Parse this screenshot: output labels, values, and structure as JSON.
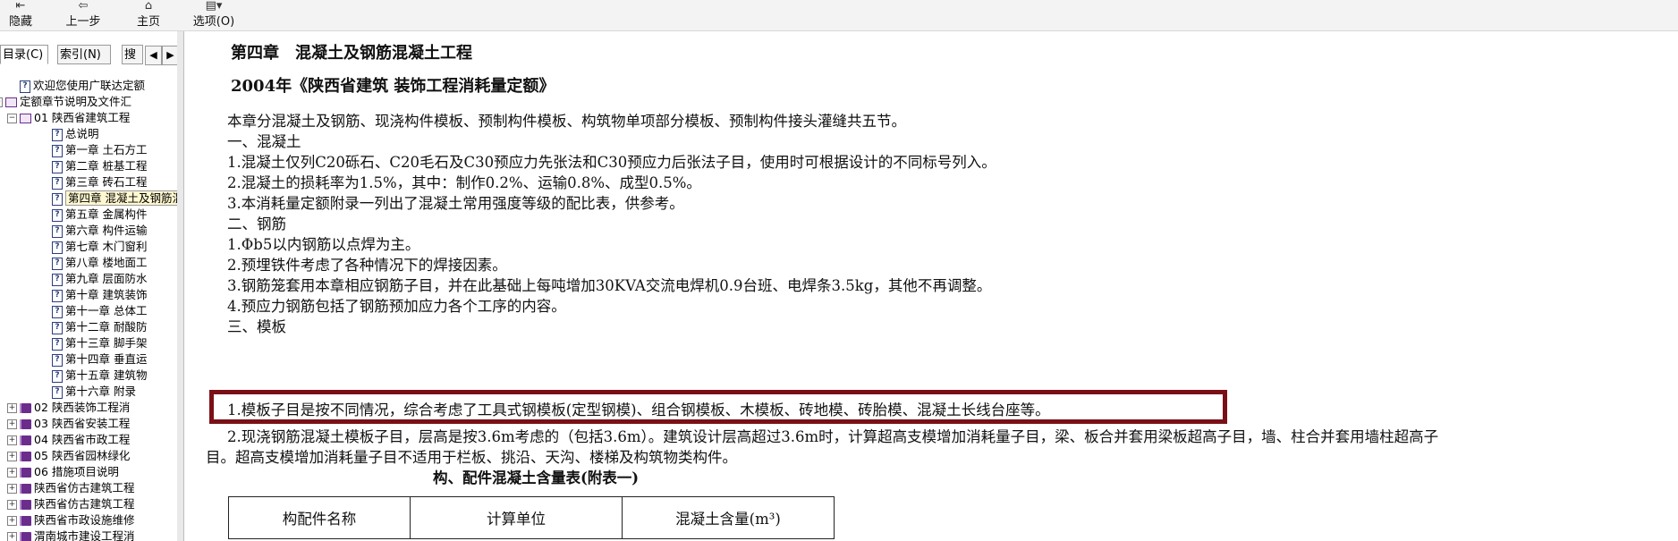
{
  "toolbar": {
    "buttons": [
      {
        "label": "隐藏",
        "icon": "hide-icon",
        "glyph": "⇤"
      },
      {
        "label": "上一步",
        "icon": "back-arrow-icon",
        "glyph": "⇦"
      },
      {
        "label": "主页",
        "icon": "home-icon",
        "glyph": "⌂"
      },
      {
        "label": "选项(O)",
        "icon": "options-icon",
        "glyph": "▤▾"
      }
    ]
  },
  "tabs": {
    "contents": "目录(C)",
    "index": "索引(N)",
    "search": "搜",
    "prev": "◀",
    "next": "▶"
  },
  "tree": [
    {
      "text": "欢迎您使用广联达定额",
      "icon": "doc",
      "level": 1
    },
    {
      "text": "定额章节说明及文件汇",
      "icon": "bookopen",
      "level": 0,
      "exp": "−"
    },
    {
      "text": "01 陕西省建筑工程",
      "icon": "bookopen",
      "level": 1,
      "exp": "−"
    },
    {
      "text": "总说明",
      "icon": "doc",
      "level": 3
    },
    {
      "text": "第一章 土石方工",
      "icon": "doc",
      "level": 3
    },
    {
      "text": "第二章 桩基工程",
      "icon": "doc",
      "level": 3
    },
    {
      "text": "第三章 砖石工程",
      "icon": "doc",
      "level": 3
    },
    {
      "text": "第四章 混凝土及钢筋混凝土工程",
      "icon": "doc",
      "level": 3,
      "selected": true
    },
    {
      "text": "第五章 金属构件",
      "icon": "doc",
      "level": 3
    },
    {
      "text": "第六章 构件运输",
      "icon": "doc",
      "level": 3
    },
    {
      "text": "第七章 木门窗利",
      "icon": "doc",
      "level": 3
    },
    {
      "text": "第八章 楼地面工",
      "icon": "doc",
      "level": 3
    },
    {
      "text": "第九章 层面防水",
      "icon": "doc",
      "level": 3
    },
    {
      "text": "第十章 建筑装饰",
      "icon": "doc",
      "level": 3
    },
    {
      "text": "第十一章 总体工",
      "icon": "doc",
      "level": 3
    },
    {
      "text": "第十二章 耐酸防",
      "icon": "doc",
      "level": 3
    },
    {
      "text": "第十三章 脚手架",
      "icon": "doc",
      "level": 3
    },
    {
      "text": "第十四章 垂直运",
      "icon": "doc",
      "level": 3
    },
    {
      "text": "第十五章 建筑物",
      "icon": "doc",
      "level": 3
    },
    {
      "text": "第十六章 附录",
      "icon": "doc",
      "level": 3
    },
    {
      "text": "02 陕西装饰工程消",
      "icon": "book",
      "level": 1,
      "exp": "+"
    },
    {
      "text": "03 陕西省安装工程",
      "icon": "book",
      "level": 1,
      "exp": "+"
    },
    {
      "text": "04 陕西省市政工程",
      "icon": "book",
      "level": 1,
      "exp": "+"
    },
    {
      "text": "05 陕西省园林绿化",
      "icon": "book",
      "level": 1,
      "exp": "+"
    },
    {
      "text": "06 措施项目说明",
      "icon": "book",
      "level": 1,
      "exp": "+"
    },
    {
      "text": "陕西省仿古建筑工程",
      "icon": "book",
      "level": 1,
      "exp": "+"
    },
    {
      "text": "陕西省仿古建筑工程",
      "icon": "book",
      "level": 1,
      "exp": "+"
    },
    {
      "text": "陕西省市政设施维修",
      "icon": "book",
      "level": 1,
      "exp": "+"
    },
    {
      "text": "渭南城市建设工程消",
      "icon": "book",
      "level": 1,
      "exp": "+"
    }
  ],
  "content": {
    "chapter_title": "第四章　混凝土及钢筋混凝土工程",
    "subtitle": "2004年《陕西省建筑 装饰工程消耗量定额》",
    "intro": "本章分混凝土及钢筋、现浇构件模板、预制构件模板、构筑物单项部分模板、预制构件接头灌缝共五节。",
    "s1": "一、混凝土",
    "s1_1": "1.混凝土仅列C20砾石、C20毛石及C30预应力先张法和C30预应力后张法子目，使用时可根据设计的不同标号列入。",
    "s1_2": "2.混凝土的损耗率为1.5%，其中：制作0.2%、运输0.8%、成型0.5%。",
    "s1_3": "3.本消耗量定额附录一列出了混凝土常用强度等级的配比表，供参考。",
    "s2": "二、钢筋",
    "s2_1": "1.Φb5以内钢筋以点焊为主。",
    "s2_2": "2.预埋铁件考虑了各种情况下的焊接因素。",
    "s2_3": "3.钢筋笼套用本章相应钢筋子目，并在此基础上每吨增加30KVA交流电焊机0.9台班、电焊条3.5kg，其他不再调整。",
    "s2_4": "4.预应力钢筋包括了钢筋预加应力各个工序的内容。",
    "s3": "三、模板",
    "s3_1": "1.模板子目是按不同情况，综合考虑了工具式钢模板(定型钢模)、组合钢模板、木模板、砖地模、砖胎模、混凝土长线台座等。",
    "s3_2": "2.现浇钢筋混凝土模板子目，层高是按3.6m考虑的（包括3.6m）。建筑设计层高超过3.6m时，计算超高支模增加消耗量子目，梁、板合并套用梁板超高子目，墙、柱合并套用墙柱超高子",
    "s3_2b": "目。超高支模增加消耗量子目不适用于栏板、挑沿、天沟、楼梯及构筑物类构件。",
    "table_title": "构、配件混凝土含量表(附表一)",
    "table_headers": [
      "构配件名称",
      "计算单位",
      "混凝土含量(m³)"
    ]
  },
  "colors": {
    "highlight_border": "#7a1016",
    "book_icon": "#6a2d8c"
  }
}
